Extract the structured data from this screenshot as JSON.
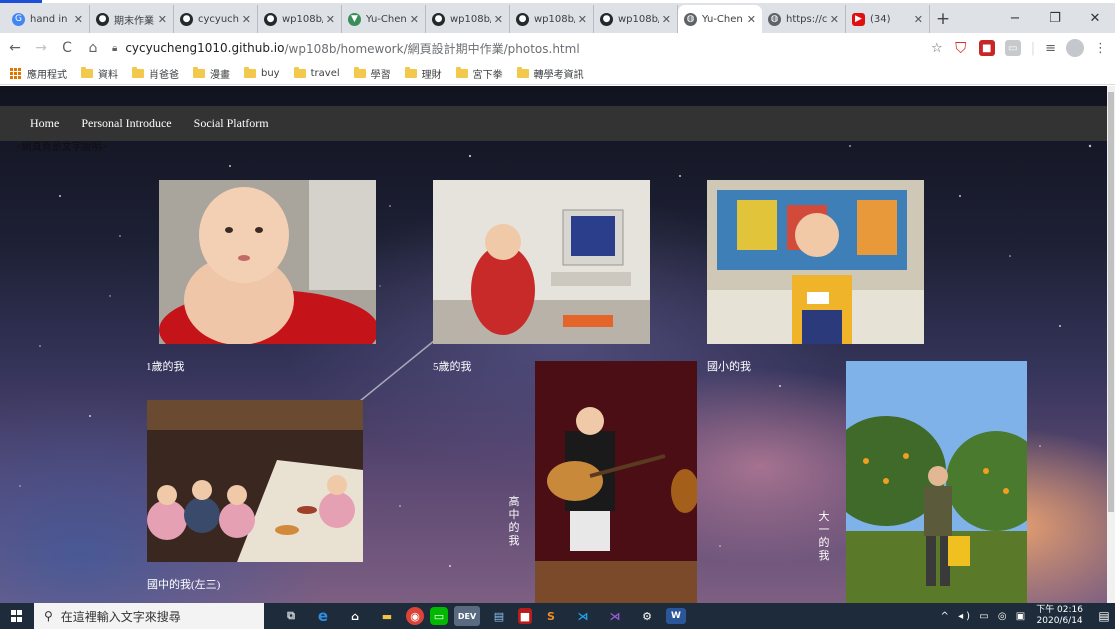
{
  "browser": {
    "tabs": [
      {
        "icon": "google-icon",
        "title": "hand in -",
        "active": false
      },
      {
        "icon": "github-icon",
        "title": "期末作業",
        "active": false
      },
      {
        "icon": "github-icon",
        "title": "cycyuche",
        "active": false
      },
      {
        "icon": "github-icon",
        "title": "wp108b/",
        "active": false
      },
      {
        "icon": "vue-icon",
        "title": "Yu-Cheng",
        "active": false
      },
      {
        "icon": "github-icon",
        "title": "wp108b/",
        "active": false
      },
      {
        "icon": "github-icon",
        "title": "wp108b/",
        "active": false
      },
      {
        "icon": "github-icon",
        "title": "wp108b/",
        "active": false
      },
      {
        "icon": "globe-icon",
        "title": "Yu-Chen",
        "active": true
      },
      {
        "icon": "globe-icon",
        "title": "https://c",
        "active": false
      },
      {
        "icon": "youtube-icon",
        "title": "(34)",
        "active": false
      }
    ],
    "new_tab": "+",
    "window_controls": {
      "minimize": "−",
      "restore": "❐",
      "close": "✕"
    },
    "nav": {
      "back": "←",
      "forward": "→",
      "reload": "C",
      "home": "⌂"
    },
    "url_host": "cycyucheng1010.github.io",
    "url_path": "/wp108b/homework/網頁設計期中作業/photos.html",
    "bookmarks": [
      {
        "icon": "apps-icon",
        "label": "應用程式"
      },
      {
        "icon": "folder-icon",
        "label": "資料"
      },
      {
        "icon": "folder-icon",
        "label": "肖爸爸"
      },
      {
        "icon": "folder-icon",
        "label": "漫畫"
      },
      {
        "icon": "folder-icon",
        "label": "buy"
      },
      {
        "icon": "folder-icon",
        "label": "travel"
      },
      {
        "icon": "folder-icon",
        "label": "學習"
      },
      {
        "icon": "folder-icon",
        "label": "理財"
      },
      {
        "icon": "folder-icon",
        "label": "宮下拳"
      },
      {
        "icon": "folder-icon",
        "label": "轉學考資訊"
      }
    ]
  },
  "page": {
    "menu": [
      "Home",
      "Personal Introduce",
      "Social Platform"
    ],
    "alt_text": "<網頁背景文字說明>",
    "photos": [
      {
        "subject": "baby in red tub",
        "caption": "1歲的我"
      },
      {
        "subject": "child at computer",
        "caption": "5歲的我"
      },
      {
        "subject": "boy in yellow shirt",
        "caption": "國小的我"
      },
      {
        "subject": "group at dinner table",
        "caption": "國中的我(左三)"
      },
      {
        "subject": "guitar performance",
        "caption": "高中的我"
      },
      {
        "subject": "orange orchard",
        "caption": "大一的我"
      }
    ]
  },
  "taskbar": {
    "search_placeholder": "在這裡輸入文字來搜尋",
    "apps": [
      "task-view-icon",
      "edge-icon",
      "store-icon",
      "explorer-icon",
      "chrome-icon",
      "line-icon",
      "dev-icon",
      "notepad-icon",
      "app-red-icon",
      "sublime-icon",
      "vscode-icon",
      "vs-icon",
      "settings-icon",
      "word-icon"
    ],
    "time": "下午 02:16",
    "date": "2020/6/14"
  }
}
